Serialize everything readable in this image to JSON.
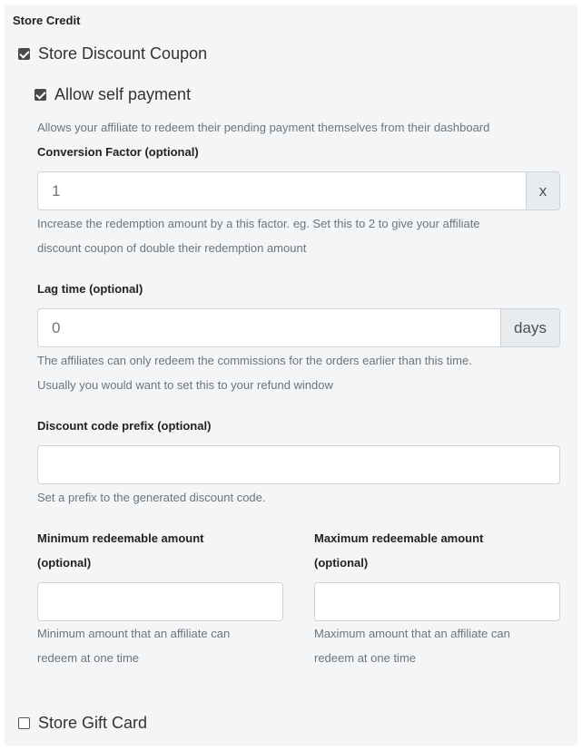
{
  "section_title": "Store Credit",
  "discount_coupon": {
    "label": "Store Discount Coupon",
    "checked": true
  },
  "self_payment": {
    "label": "Allow self payment",
    "checked": true,
    "help": "Allows your affiliate to redeem their pending payment themselves from their dashboard"
  },
  "conversion_factor": {
    "label": "Conversion Factor (optional)",
    "value": "1",
    "addon": "x",
    "help_line1": "Increase the redemption amount by a this factor. eg. Set this to 2 to give your affiliate",
    "help_line2": "discount coupon of double their redemption amount"
  },
  "lag_time": {
    "label": "Lag time (optional)",
    "value": "0",
    "addon": "days",
    "help_line1": "The affiliates can only redeem the commissions for the orders earlier than this time.",
    "help_line2": "Usually you would want to set this to your refund window"
  },
  "discount_prefix": {
    "label": "Discount code prefix (optional)",
    "value": "",
    "help": "Set a prefix to the generated discount code."
  },
  "min_amount": {
    "label_line1": "Minimum redeemable amount",
    "label_line2": "(optional)",
    "value": "",
    "help_line1": "Minimum amount that an affiliate can",
    "help_line2": "redeem at one time"
  },
  "max_amount": {
    "label_line1": "Maximum redeemable amount",
    "label_line2": "(optional)",
    "value": "",
    "help_line1": "Maximum amount that an affiliate can",
    "help_line2": "redeem at one time"
  },
  "gift_card": {
    "label": "Store Gift Card",
    "checked": false
  }
}
